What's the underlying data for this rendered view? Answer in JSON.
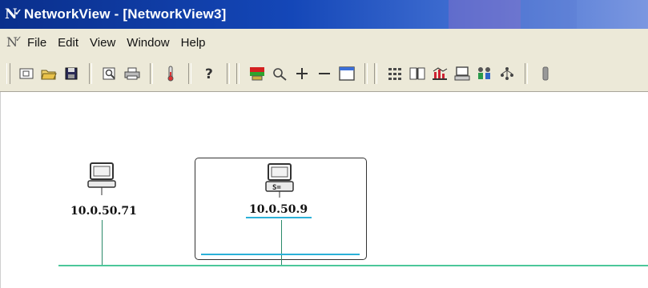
{
  "window": {
    "title": "NetworkView - [NetworkView3]"
  },
  "menubar": {
    "items": [
      "File",
      "Edit",
      "View",
      "Window",
      "Help"
    ]
  },
  "toolbar": {
    "icons": [
      "new-icon",
      "open-icon",
      "save-icon",
      "print-preview-icon",
      "print-icon",
      "alarm-icon",
      "help-icon",
      "status-map-icon",
      "zoom-icon",
      "zoom-in-icon",
      "zoom-out-icon",
      "window-icon",
      "node-list-icon",
      "book-icon",
      "chart-icon",
      "monitor-icon",
      "users-icon",
      "tree-icon",
      "gray-bar-icon"
    ]
  },
  "canvas": {
    "nodes": [
      {
        "label": "10.0.50.71",
        "icon": "workstation-icon",
        "selected": false
      },
      {
        "label": "10.0.50.9",
        "icon": "server-icon",
        "selected": true
      }
    ],
    "colors": {
      "segment": "#4cc79a",
      "selection_underline": "#2bb0d8",
      "title_bar": "#1447b8"
    }
  }
}
